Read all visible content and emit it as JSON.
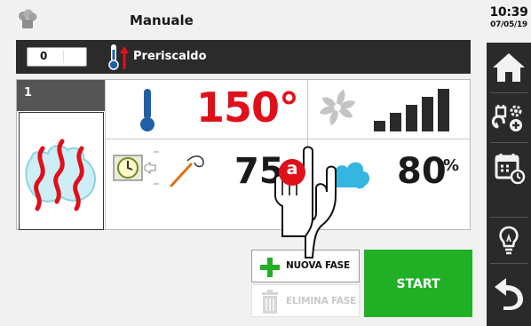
{
  "header": {
    "title": "Manuale",
    "time": "10:39",
    "date": "07/05/19"
  },
  "status_bar": {
    "switch_label": "0",
    "mode_label": "Preriscaldo"
  },
  "phase": {
    "number": "1"
  },
  "readings": {
    "temperature": "150°",
    "time": "75",
    "humidity": "80",
    "humidity_unit": "%",
    "fan_level_bars": 5
  },
  "buttons": {
    "new_phase": "NUOVA FASE",
    "delete_phase": "ELIMINA FASE",
    "start": "START"
  },
  "overlay": {
    "badge": "a"
  },
  "sidebar": {
    "items": [
      "home-icon",
      "program-settings-icon",
      "calendar-icon",
      "lightbulb-icon",
      "back-icon"
    ]
  },
  "colors": {
    "accent_red": "#e0101b",
    "start_green": "#21b025",
    "dark_panel": "#2b2b2b",
    "icon_blue": "#1f5fa8"
  }
}
